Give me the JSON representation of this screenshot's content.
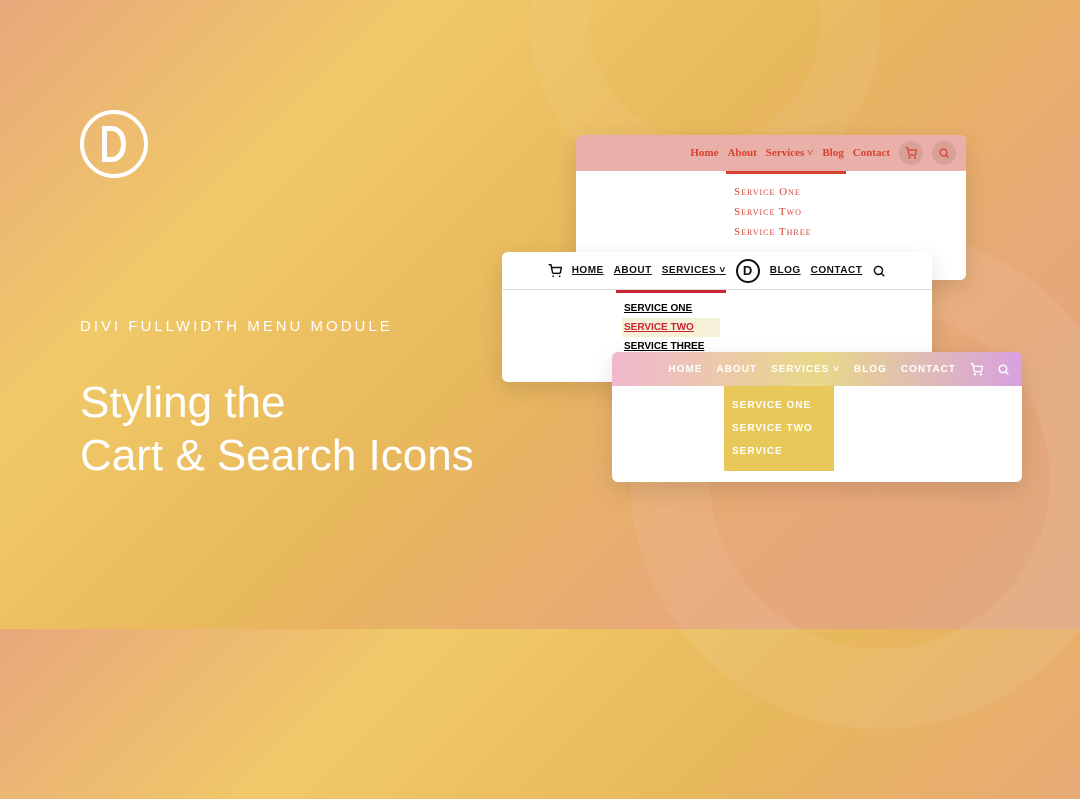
{
  "eyebrow": "DIVI FULLWIDTH MENU MODULE",
  "headline_line1": "Styling the",
  "headline_line2": "Cart & Search Icons",
  "menu1": {
    "items": [
      "Home",
      "About",
      "Services",
      "Blog",
      "Contact"
    ],
    "dropdown": [
      "Service One",
      "Service Two",
      "Service Three"
    ]
  },
  "menu2": {
    "items_left": [
      "HOME",
      "ABOUT",
      "SERVICES"
    ],
    "items_right": [
      "BLOG",
      "CONTACT"
    ],
    "dropdown": [
      "SERVICE ONE",
      "SERVICE TWO",
      "SERVICE THREE"
    ]
  },
  "menu3": {
    "items": [
      "HOME",
      "ABOUT",
      "SERVICES",
      "BLOG",
      "CONTACT"
    ],
    "dropdown": [
      "SERVICE ONE",
      "SERVICE TWO",
      "SERVICE"
    ]
  }
}
